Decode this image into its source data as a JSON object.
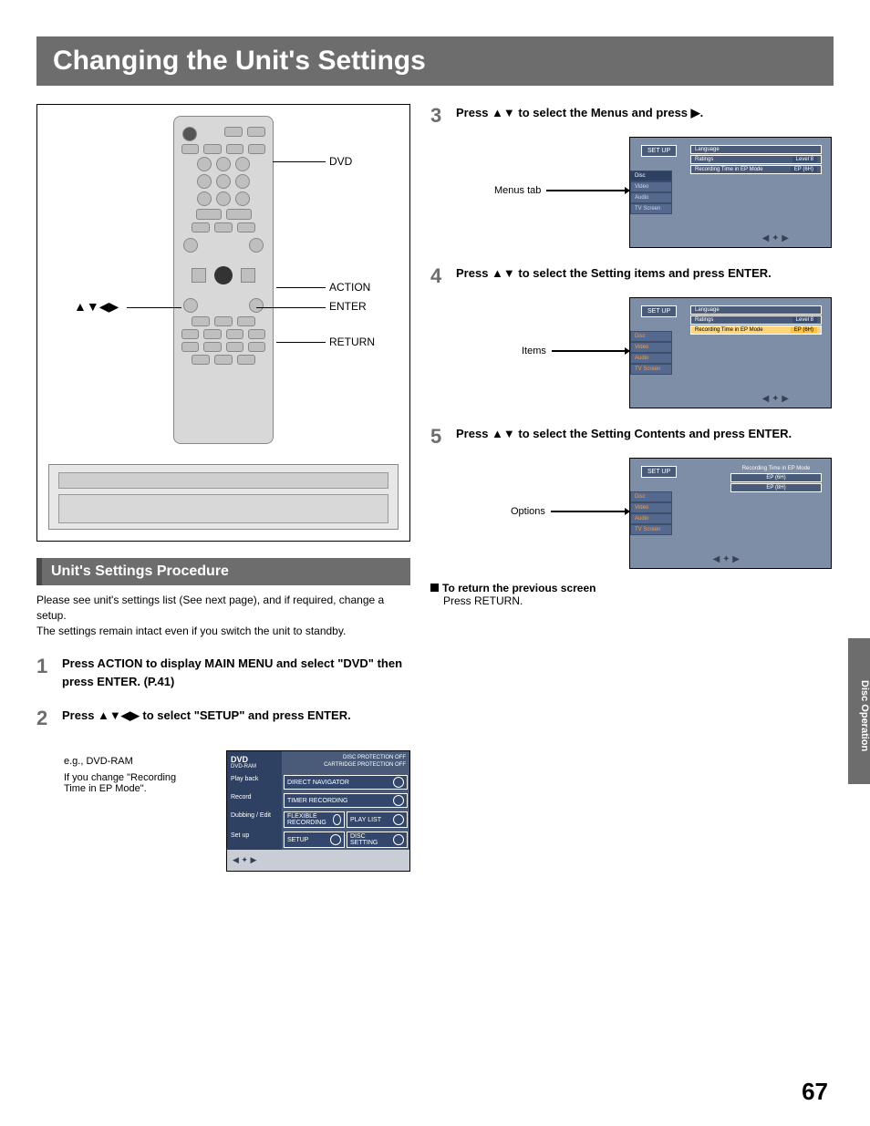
{
  "page": {
    "title": "Changing the Unit's Settings",
    "number": "67",
    "side_tab": "Disc Operation"
  },
  "diagram": {
    "labels": {
      "dvd": "DVD",
      "action": "ACTION",
      "enter": "ENTER",
      "return": "RETURN",
      "arrows": "▲▼◀▶"
    }
  },
  "section": {
    "heading": "Unit's Settings Procedure"
  },
  "intro": {
    "l1": "Please see unit's settings list (See next page), and if required, change a setup.",
    "l2": "The settings remain intact even if you switch the unit to standby."
  },
  "steps": {
    "s1": {
      "n": "1",
      "t": "Press ACTION to display MAIN MENU and select \"DVD\" then press ENTER. (P.41)"
    },
    "s2": {
      "n": "2",
      "t": "Press ▲▼◀▶ to select \"SETUP\" and press ENTER."
    },
    "s2_note": {
      "l1": "e.g., DVD-RAM",
      "l2": "If you change \"Recording Time in EP Mode\"."
    },
    "s3": {
      "n": "3",
      "t": "Press ▲▼ to select the Menus and press ▶."
    },
    "s3_label": "Menus tab",
    "s4": {
      "n": "4",
      "t": "Press ▲▼ to select the Setting items and press ENTER."
    },
    "s4_label": "Items",
    "s5": {
      "n": "5",
      "t": "Press ▲▼ to select the Setting Contents and press ENTER."
    },
    "s5_label": "Options"
  },
  "return_block": {
    "hd": "To return the previous screen",
    "body": "Press RETURN."
  },
  "dvd_menu": {
    "title": "DVD",
    "sub": "DVD-RAM",
    "status1": "DISC PROTECTION  OFF",
    "status2": "CARTRIDGE PROTECTION  OFF",
    "rows": {
      "playback": "Play back",
      "record": "Record",
      "dubbing": "Dubbing / Edit",
      "setup": "Set up"
    },
    "cells": {
      "direct_nav": "DIRECT NAVIGATOR",
      "timer_rec": "TIMER RECORDING",
      "flex_rec": "FLEXIBLE RECORDING",
      "play_list": "PLAY LIST",
      "setup": "SETUP",
      "disc_setting": "DISC SETTING"
    }
  },
  "osd": {
    "setup": "SET UP",
    "side": {
      "disc": "Disc",
      "video": "Video",
      "audio": "Audio",
      "tv": "TV Screen"
    },
    "items": {
      "lang": "Language",
      "ratings": "Ratings",
      "ratings_v": "Level 8",
      "rectime": "Recording Time in EP Mode",
      "rectime_v": "EP (6H)"
    },
    "opts": {
      "title": "Recording Time in EP Mode",
      "a": "EP (6H)",
      "b": "EP (8H)"
    }
  }
}
